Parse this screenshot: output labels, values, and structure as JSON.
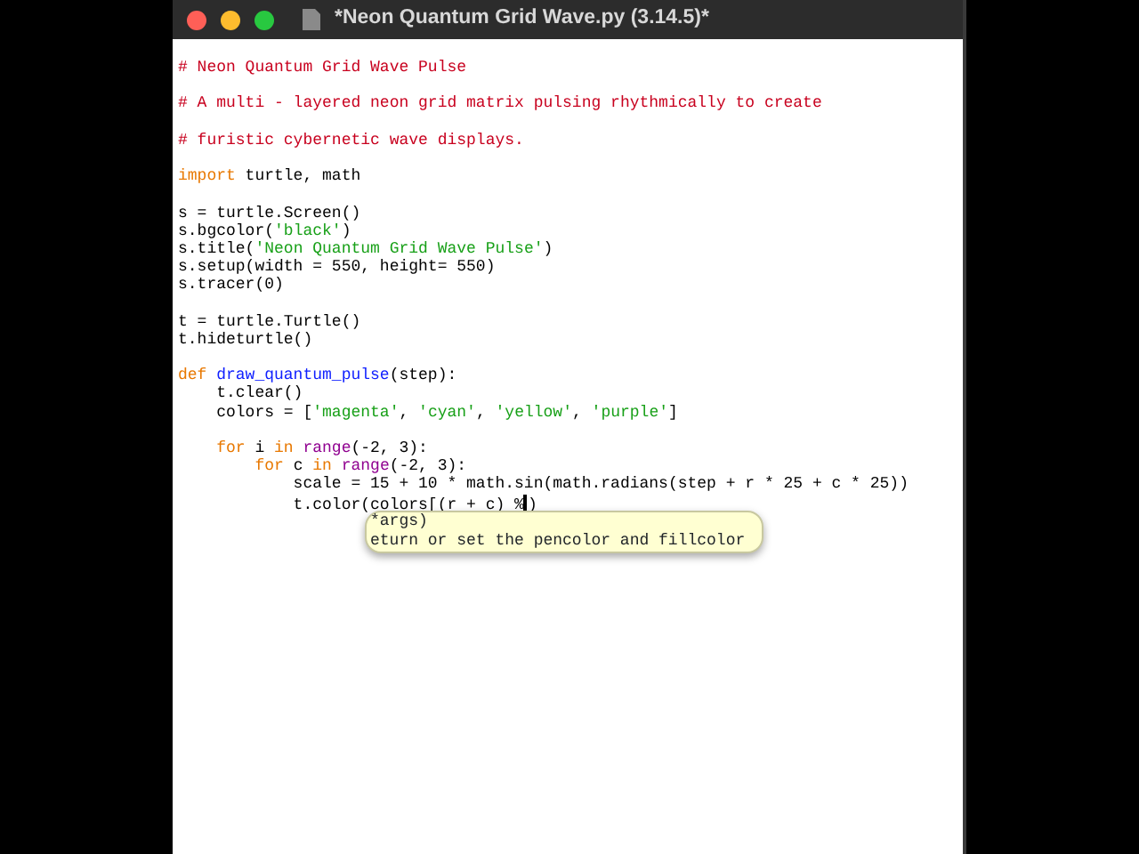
{
  "window": {
    "title": "*Neon Quantum Grid Wave.py (3.14.5)*"
  },
  "editor": {
    "lines": [
      {
        "kind": "code",
        "tokens": [
          {
            "text": "# Neon Quantum Grid Wave Pulse",
            "kind": "comment"
          }
        ]
      },
      {
        "kind": "blank"
      },
      {
        "kind": "code",
        "tokens": [
          {
            "text": "# A multi - layered neon grid matrix pulsing rhythmically to create",
            "kind": "comment"
          }
        ]
      },
      {
        "kind": "blank"
      },
      {
        "kind": "code",
        "tokens": [
          {
            "text": "# furistic cybernetic wave displays.",
            "kind": "comment"
          }
        ]
      },
      {
        "kind": "blank"
      },
      {
        "kind": "code",
        "tokens": [
          {
            "text": "import",
            "kind": "keyword"
          },
          {
            "text": " turtle, math",
            "kind": "plain"
          }
        ]
      },
      {
        "kind": "blank"
      },
      {
        "kind": "code",
        "tokens": [
          {
            "text": "s = turtle.Screen()",
            "kind": "plain"
          }
        ]
      },
      {
        "kind": "code",
        "tokens": [
          {
            "text": "s.bgcolor(",
            "kind": "plain"
          },
          {
            "text": "'black'",
            "kind": "string"
          },
          {
            "text": ")",
            "kind": "plain"
          }
        ]
      },
      {
        "kind": "code",
        "tokens": [
          {
            "text": "s.title(",
            "kind": "plain"
          },
          {
            "text": "'Neon Quantum Grid Wave Pulse'",
            "kind": "string"
          },
          {
            "text": ")",
            "kind": "plain"
          }
        ]
      },
      {
        "kind": "code",
        "tokens": [
          {
            "text": "s.setup(width = 550, height= 550)",
            "kind": "plain"
          }
        ]
      },
      {
        "kind": "code",
        "tokens": [
          {
            "text": "s.tracer(0)",
            "kind": "plain"
          }
        ]
      },
      {
        "kind": "blank"
      },
      {
        "kind": "code",
        "tokens": [
          {
            "text": "t = turtle.Turtle()",
            "kind": "plain"
          }
        ]
      },
      {
        "kind": "code",
        "tokens": [
          {
            "text": "t.hideturtle()",
            "kind": "plain"
          }
        ]
      },
      {
        "kind": "blank"
      },
      {
        "kind": "code",
        "tokens": [
          {
            "text": "def",
            "kind": "keyword"
          },
          {
            "text": " draw_quantum_pulse",
            "kind": "defname"
          },
          {
            "text": "(step):",
            "kind": "plain"
          }
        ]
      },
      {
        "kind": "code",
        "tokens": [
          {
            "text": "    t.clear()",
            "kind": "plain"
          }
        ]
      },
      {
        "kind": "code",
        "tokens": [
          {
            "text": "    colors = [",
            "kind": "plain"
          },
          {
            "text": "'magenta'",
            "kind": "string"
          },
          {
            "text": ", ",
            "kind": "plain"
          },
          {
            "text": "'cyan'",
            "kind": "string"
          },
          {
            "text": ", ",
            "kind": "plain"
          },
          {
            "text": "'yellow'",
            "kind": "string"
          },
          {
            "text": ", ",
            "kind": "plain"
          },
          {
            "text": "'purple'",
            "kind": "string"
          },
          {
            "text": "]",
            "kind": "plain"
          }
        ]
      },
      {
        "kind": "blank"
      },
      {
        "kind": "code",
        "tokens": [
          {
            "text": "    for",
            "kind": "keyword"
          },
          {
            "text": " i ",
            "kind": "plain"
          },
          {
            "text": "in",
            "kind": "keyword"
          },
          {
            "text": " range",
            "kind": "builtin"
          },
          {
            "text": "(-2, 3):",
            "kind": "plain"
          }
        ]
      },
      {
        "kind": "code",
        "tokens": [
          {
            "text": "        for",
            "kind": "keyword"
          },
          {
            "text": " c ",
            "kind": "plain"
          },
          {
            "text": "in",
            "kind": "keyword"
          },
          {
            "text": " range",
            "kind": "builtin"
          },
          {
            "text": "(-2, 3):",
            "kind": "plain"
          }
        ]
      },
      {
        "kind": "code",
        "tokens": [
          {
            "text": "            scale = 15 + 10 * math.sin(math.radians(step + r * 25 + c * 25))",
            "kind": "plain"
          }
        ]
      },
      {
        "kind": "code",
        "tokens": [
          {
            "text": "            t.color(colors[(r + c) %",
            "kind": "plain"
          },
          {
            "kind": "cursor"
          },
          {
            "text": ")",
            "kind": "plain"
          }
        ]
      }
    ]
  },
  "calltip": {
    "lines": [
      "*args)",
      "eturn or set the pencolor and fillcolor"
    ]
  }
}
